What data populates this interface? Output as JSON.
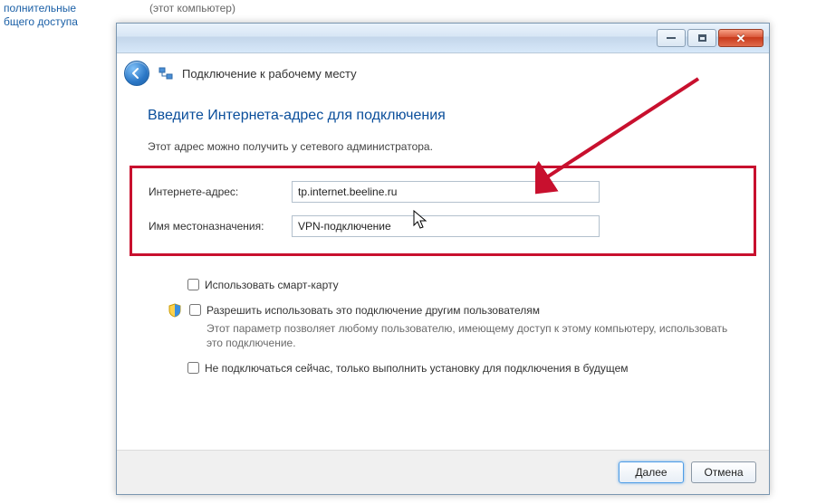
{
  "background": {
    "line1": "полнительные",
    "line2": "бщего доступа",
    "snippet2": "(этот компьютер)"
  },
  "window": {
    "title": "Подключение к рабочему месту",
    "buttons": {
      "minimize_tooltip": "Свернуть",
      "maximize_tooltip": "Развернуть",
      "close_tooltip": "Закрыть"
    }
  },
  "content": {
    "heading": "Введите Интернета-адрес для подключения",
    "subtext": "Этот адрес можно получить у сетевого администратора.",
    "form": {
      "address_label": "Интернете-адрес:",
      "address_value": "tp.internet.beeline.ru",
      "destination_label": "Имя местоназначения:",
      "destination_value": "VPN-подключение"
    },
    "checkboxes": {
      "smartcard": {
        "label": "Использовать смарт-карту",
        "checked": false
      },
      "allow_others": {
        "label": "Разрешить использовать это подключение другим пользователям",
        "desc": "Этот параметр позволяет любому пользователю, имеющему доступ к этому компьютеру, использовать это подключение.",
        "checked": false
      },
      "dont_connect": {
        "label": "Не подключаться сейчас, только выполнить установку для подключения в будущем",
        "checked": false
      }
    }
  },
  "footer": {
    "next": "Далее",
    "cancel": "Отмена"
  },
  "colors": {
    "highlight": "#c8102e",
    "heading": "#0a4e9b"
  }
}
